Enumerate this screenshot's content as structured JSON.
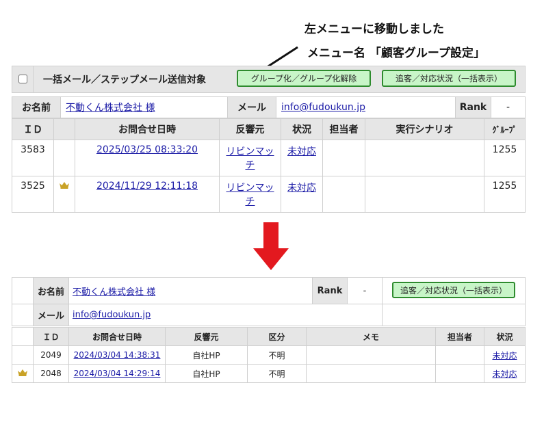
{
  "annotation": {
    "line1": "左メニューに移動しました",
    "line2": "メニュー名 「顧客グループ設定」"
  },
  "top": {
    "bulk_label": "一括メール／ステップメール送信対象",
    "group_button": "グループ化／グループ化解除",
    "followup_button": "追客／対応状況（一括表示）",
    "name_label": "お名前",
    "name_value": "不動くん株式会社 様",
    "mail_label": "メール",
    "mail_value": "info@fudoukun.jp",
    "rank_label": "Rank",
    "rank_value": "-",
    "columns": [
      "ＩＤ",
      "",
      "お問合せ日時",
      "反響元",
      "状況",
      "担当者",
      "実行シナリオ",
      "ｸﾞﾙｰﾌﾟ"
    ],
    "rows": [
      {
        "id": "3583",
        "crown": false,
        "datetime": "2025/03/25 08:33:20",
        "source": "リビンマッチ",
        "status": "未対応",
        "staff": "",
        "scenario": "",
        "group": "1255"
      },
      {
        "id": "3525",
        "crown": true,
        "datetime": "2024/11/29 12:11:18",
        "source": "リビンマッチ",
        "status": "未対応",
        "staff": "",
        "scenario": "",
        "group": "1255"
      }
    ]
  },
  "bottom": {
    "name_label": "お名前",
    "name_value": "不動くん株式会社 様",
    "rank_label": "Rank",
    "rank_value": "-",
    "followup_button": "追客／対応状況（一括表示）",
    "mail_label": "メール",
    "mail_value": "info@fudoukun.jp",
    "columns": [
      "ＩＤ",
      "お問合せ日時",
      "反響元",
      "区分",
      "メモ",
      "担当者",
      "状況"
    ],
    "rows": [
      {
        "id": "2049",
        "crown": false,
        "datetime": "2024/03/04 14:38:31",
        "source": "自社HP",
        "category": "不明",
        "memo": "",
        "staff": "",
        "status": "未対応"
      },
      {
        "id": "2048",
        "crown": true,
        "datetime": "2024/03/04 14:29:14",
        "source": "自社HP",
        "category": "不明",
        "memo": "",
        "staff": "",
        "status": "未対応"
      }
    ]
  },
  "colors": {
    "arrow": "#e3191f",
    "button_bg": "#c8f5c8",
    "button_border": "#2e8b2e",
    "link": "#1a1aa6",
    "crown": "#c9a227"
  }
}
